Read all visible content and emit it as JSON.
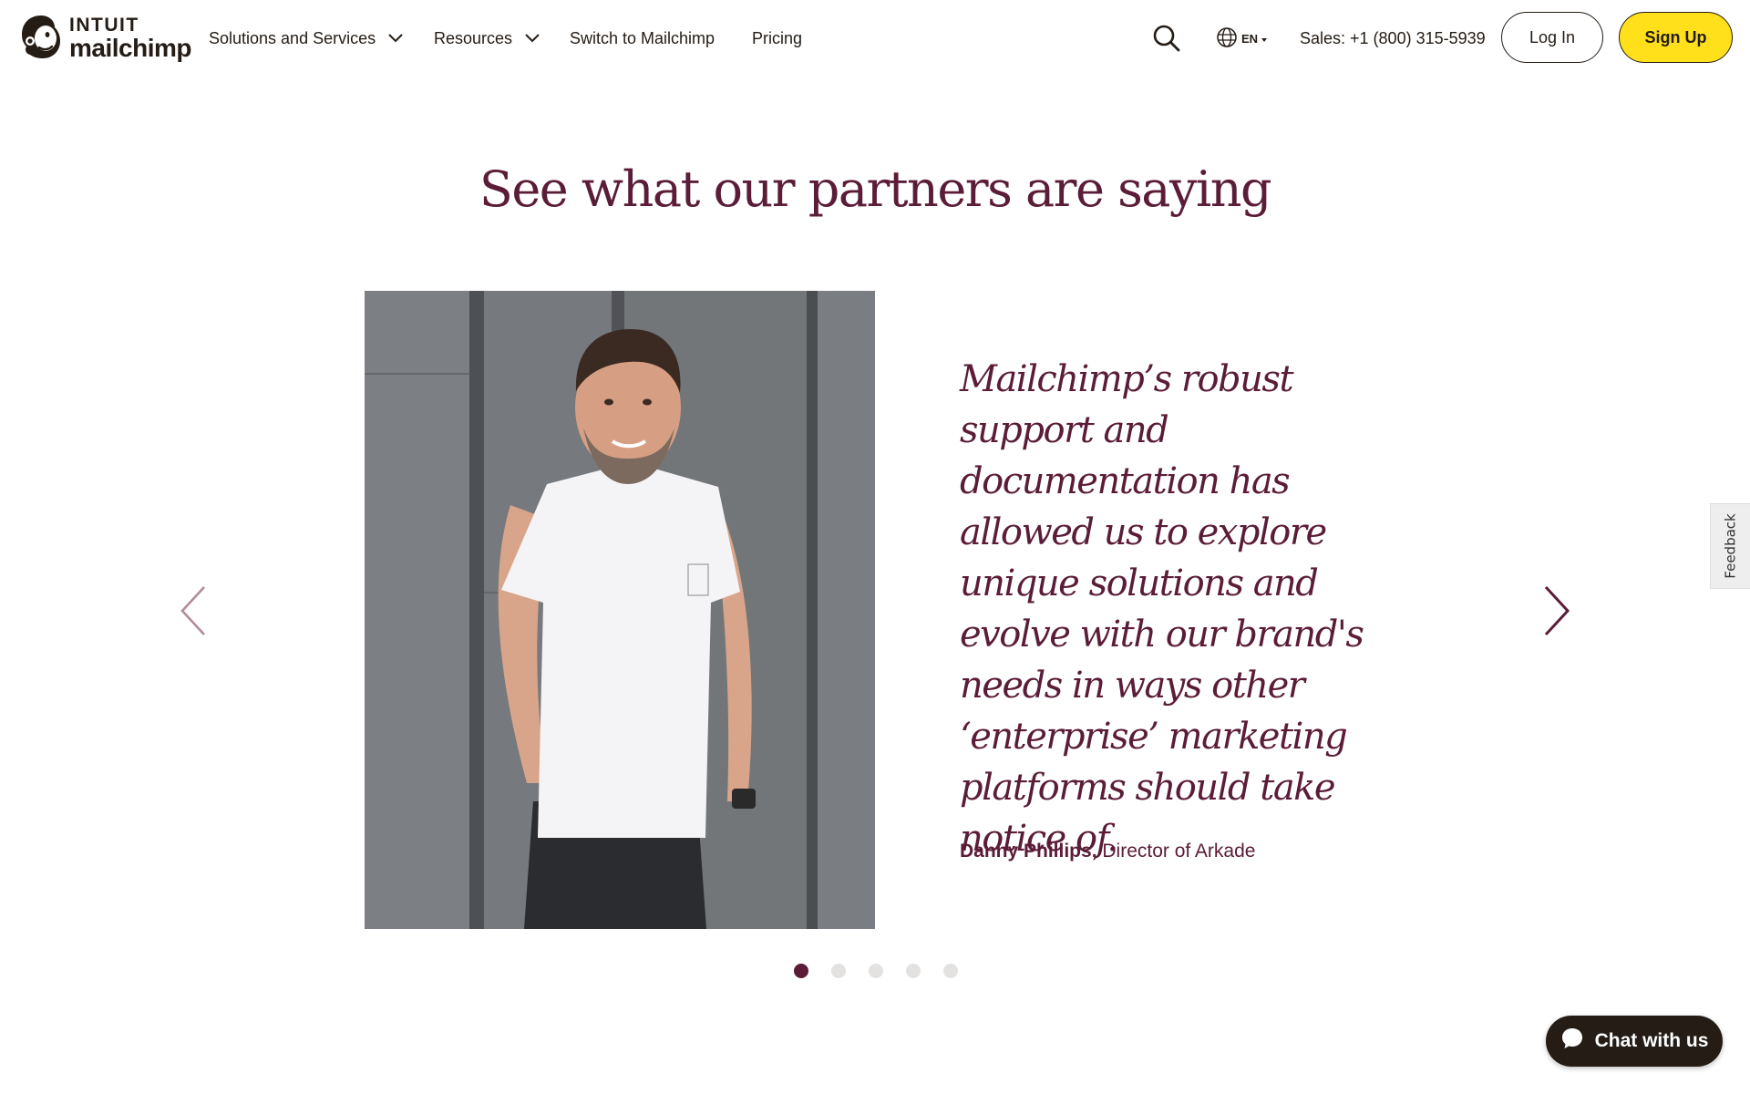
{
  "header": {
    "logo": {
      "intuit_text": "INTUIT",
      "brand_text": "mailchimp",
      "icon": "freddie-logo-icon"
    },
    "nav": [
      {
        "label": "Solutions and Services",
        "has_dropdown": true
      },
      {
        "label": "Resources",
        "has_dropdown": true
      },
      {
        "label": "Switch to Mailchimp",
        "has_dropdown": false
      },
      {
        "label": "Pricing",
        "has_dropdown": false
      }
    ],
    "search_icon": "search-icon",
    "language": {
      "label": "EN",
      "icon": "globe-icon"
    },
    "sales": "Sales: +1 (800) 315-5939",
    "login_label": "Log In",
    "signup_label": "Sign Up"
  },
  "testimonials": {
    "title": "See what our partners are saying",
    "quote": "Mailchimp’s robust support and documentation has allowed us to explore unique solutions and evolve with our brand's needs in ways other ‘enterprise’ marketing platforms should take notice of.",
    "author_name": "Danny Phillips,",
    "author_role": "Director of Arkade",
    "prev_icon": "chevron-left-icon",
    "next_icon": "chevron-right-icon",
    "slide_count": 5,
    "active_slide": 1
  },
  "feedback_label": "Feedback",
  "chat_label": "Chat with us",
  "colors": {
    "brand_plum": "#5b1c38",
    "brand_yellow": "#ffe01b",
    "text_dark": "#241c15"
  }
}
